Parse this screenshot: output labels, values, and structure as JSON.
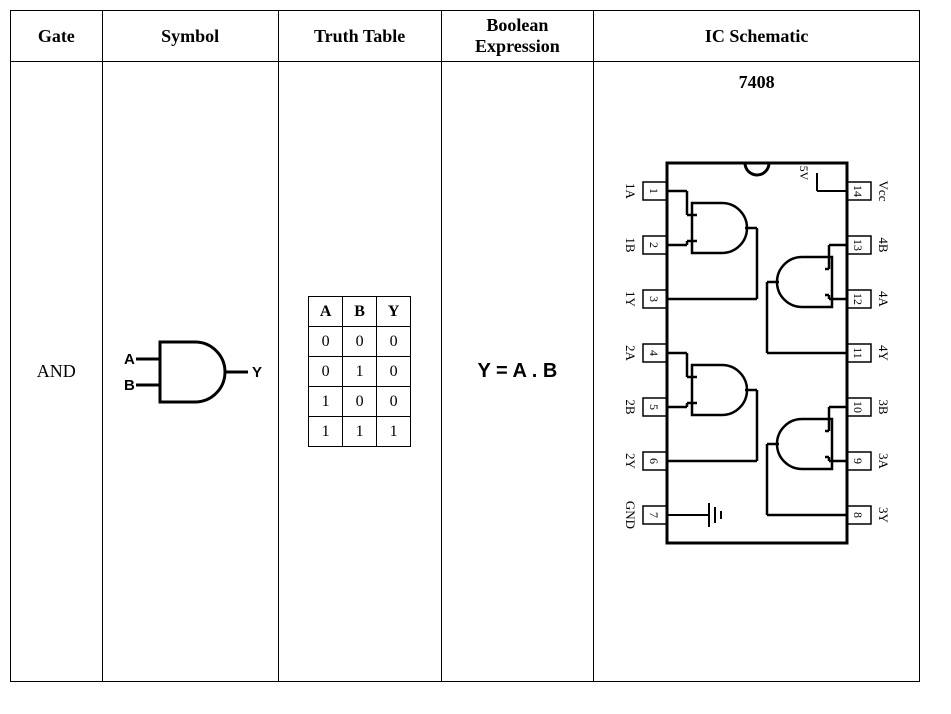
{
  "headers": {
    "gate": "Gate",
    "symbol": "Symbol",
    "truth": "Truth Table",
    "boolean_l1": "Boolean",
    "boolean_l2": "Expression",
    "ic": "IC Schematic"
  },
  "gate": {
    "name": "AND",
    "symbol_inputs": {
      "a": "A",
      "b": "B"
    },
    "symbol_output": "Y",
    "boolean": "Y = A . B"
  },
  "truth_table": {
    "cols": [
      "A",
      "B",
      "Y"
    ],
    "rows": [
      [
        "0",
        "0",
        "0"
      ],
      [
        "0",
        "1",
        "0"
      ],
      [
        "1",
        "0",
        "0"
      ],
      [
        "1",
        "1",
        "1"
      ]
    ]
  },
  "ic": {
    "part": "7408",
    "left_pins": [
      {
        "num": "1",
        "label": "1A"
      },
      {
        "num": "2",
        "label": "1B"
      },
      {
        "num": "3",
        "label": "1Y"
      },
      {
        "num": "4",
        "label": "2A"
      },
      {
        "num": "5",
        "label": "2B"
      },
      {
        "num": "6",
        "label": "2Y"
      },
      {
        "num": "7",
        "label": "GND"
      }
    ],
    "right_pins": [
      {
        "num": "14",
        "label": "Vcc"
      },
      {
        "num": "13",
        "label": "4B"
      },
      {
        "num": "12",
        "label": "4A"
      },
      {
        "num": "11",
        "label": "4Y"
      },
      {
        "num": "10",
        "label": "3B"
      },
      {
        "num": "9",
        "label": "3A"
      },
      {
        "num": "8",
        "label": "3Y"
      }
    ],
    "supply": "5V"
  }
}
